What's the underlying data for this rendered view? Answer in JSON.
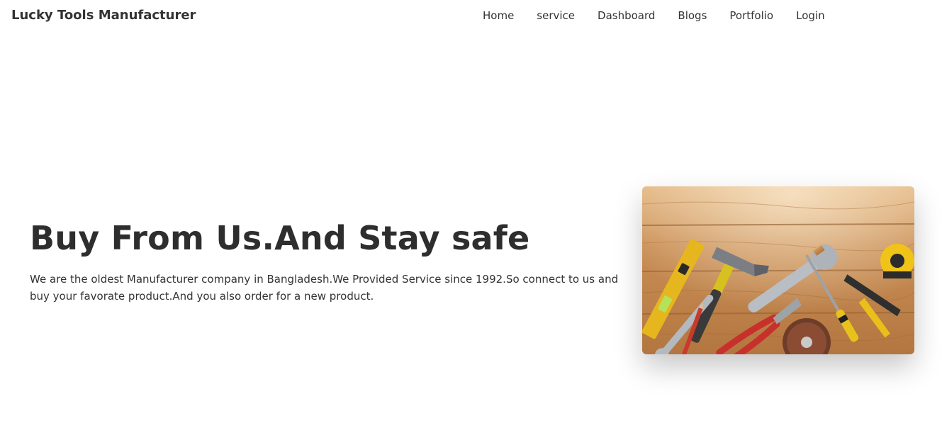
{
  "navbar": {
    "brand": "Lucky Tools Manufacturer",
    "links": [
      "Home",
      "service",
      "Dashboard",
      "Blogs",
      "Portfolio",
      "Login"
    ]
  },
  "hero": {
    "title": "Buy From Us.And Stay safe",
    "description": "We are the oldest Manufacturer company in Bangladesh.We Provided Service since 1992.So connect to us and buy your favorate product.And you also order for a new product.",
    "image_icon": "tools-on-wooden-table-image"
  },
  "colors": {
    "text": "#333333",
    "wood": "#c88f55",
    "background": "#ffffff"
  }
}
